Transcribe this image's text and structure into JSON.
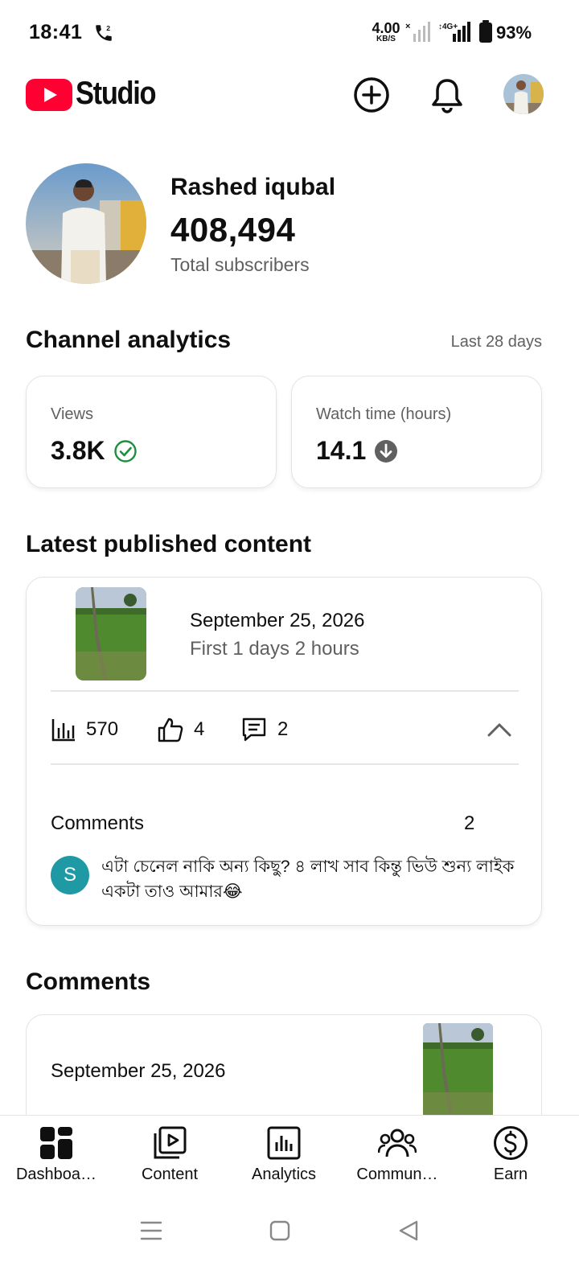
{
  "status_bar": {
    "time": "18:41",
    "net_speed": "4.00",
    "net_unit": "KB/S",
    "battery": "93%"
  },
  "header": {
    "app_name": "Studio"
  },
  "channel": {
    "name": "Rashed iqubal",
    "subscribers": "408,494",
    "subscribers_label": "Total subscribers"
  },
  "analytics": {
    "title": "Channel analytics",
    "period": "Last 28 days",
    "metrics": [
      {
        "label": "Views",
        "value": "3.8K",
        "indicator": "check-circle-icon"
      },
      {
        "label": "Watch time (hours)",
        "value": "14.1",
        "indicator": "arrow-down-circle-icon"
      }
    ]
  },
  "latest": {
    "title": "Latest published content",
    "date": "September 25, 2026",
    "subtitle": "First 1 days 2 hours",
    "views": "570",
    "likes": "4",
    "comments": "2",
    "comments_label": "Comments",
    "comments_count": "2",
    "comment": {
      "avatar_letter": "S",
      "text": "এটা চেনেল নাকি অন্য কিছু? ৪ লাখ সাব কিন্তু ভিউ শুন্য লাইক একটা তাও আমার😂"
    }
  },
  "comments_section": {
    "title": "Comments",
    "date": "September 25, 2026"
  },
  "bottom_nav": [
    {
      "label": "Dashboa…",
      "icon": "dashboard-icon"
    },
    {
      "label": "Content",
      "icon": "content-icon"
    },
    {
      "label": "Analytics",
      "icon": "analytics-icon"
    },
    {
      "label": "Commun…",
      "icon": "community-icon"
    },
    {
      "label": "Earn",
      "icon": "earn-icon"
    }
  ],
  "colors": {
    "brand_red": "#ff0033",
    "check_green": "#1e8e3e",
    "commenter_avatar": "#1f9aa4"
  }
}
